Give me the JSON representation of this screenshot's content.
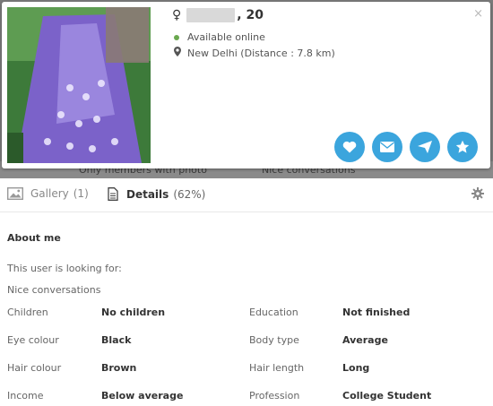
{
  "backdrop": {
    "left_text": "Only members with photo",
    "right_text": "Nice conversations"
  },
  "profile": {
    "gender_symbol": "♀",
    "age": ", 20",
    "status": "Available online",
    "location": "New Delhi (Distance : 7.8 km)",
    "close": "×",
    "status_color": "#6aa84f",
    "action_color": "#3ba5dd"
  },
  "actions": [
    {
      "name": "like-button",
      "icon": "heart-icon"
    },
    {
      "name": "message-button",
      "icon": "envelope-icon"
    },
    {
      "name": "wink-button",
      "icon": "send-icon"
    },
    {
      "name": "favorite-button",
      "icon": "star-icon"
    }
  ],
  "tabs": {
    "gallery_label": "Gallery",
    "gallery_count": "(1)",
    "details_label": "Details",
    "details_percent": "(62%)"
  },
  "about": {
    "heading": "About me",
    "looking_for": "This user is looking for:",
    "looking_value": "Nice conversations"
  },
  "details": [
    {
      "label": "Children",
      "value": "No children",
      "label2": "Education",
      "value2": "Not finished"
    },
    {
      "label": "Eye colour",
      "value": "Black",
      "label2": "Body type",
      "value2": "Average"
    },
    {
      "label": "Hair colour",
      "value": "Brown",
      "label2": "Hair length",
      "value2": "Long"
    },
    {
      "label": "Income",
      "value": "Below average",
      "label2": "Profession",
      "value2": "College Student"
    }
  ]
}
